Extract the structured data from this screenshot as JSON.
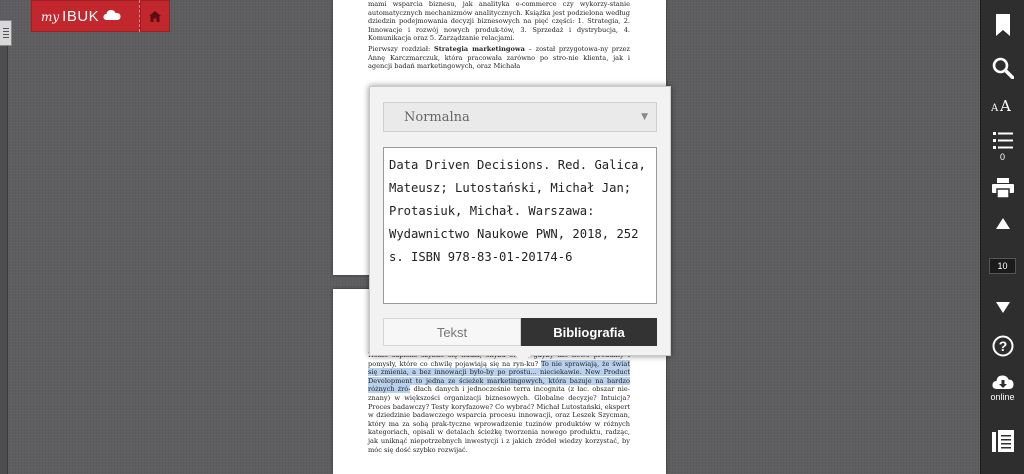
{
  "logo": {
    "my": "my",
    "brand": "IBUK"
  },
  "page1": {
    "paragraphs": [
      "mami wsparcia biznesu, jak analityka e-commerce czy wykorzy-stanie automatycznych mechanizmów analitycznych. Książka jest podzielona według dziedzin podejmowania decyzji biznesowych na pięć części: 1. Strategia, 2. Innowacje i rozwój nowych produk-tów, 3. Sprzedaż i dystrybucja, 4. Komunikacja oraz 5. Zarządzanie relacjami.",
      "Pierwszy rozdział: Strategia marketingowa – został przygotowa-ny przez Annę Karczmarczuk, która pracowała zarówno po stro-nie klienta, jak i agencji badań marketingowych, oraz Michała"
    ],
    "bold_phrase": "Strategia marketingowa"
  },
  "page2": {
    "line1": "Homo sapiens szybko się nudzi, chyba świat, gdyby nie",
    "line2": "nowe produkty i pomysły, które co chwilę pojawiają się na ryn-ku?",
    "highlighted": "To nie sprawiają, że świat się zmienia, a bez innowacji było-by po prostu... nieciekawie. New Product Development to jedna ze ścieżek marketingowych, która bazuje na bardzo różnych źró-",
    "rest": "dłach danych i jednocześnie terra incognita (z łac. obszar nie-znany) w większości organizacji biznesowych. Globalne decyzje? Intuicja? Proces badawczy? Testy koryfazowe? Co wybrać? Michał Lutostański, ekspert w dziedzinie badawczego wsparcia procesu innowacji, oraz Leszek Szycman, który ma za sobą prak-tyczne wprowadzenie tuzinów produktów w różnych kategoriach, opisali w detalach ścieżkę tworzenia nowego produktu, radząc, jak uniknąć niepotrzebnych inwestycji i z jakich źródeł wiedzy korzystać, by móc się dość szybko rozwijać."
  },
  "popup": {
    "style_select": {
      "value": "Normalna"
    },
    "citation": "Data Driven Decisions. Red. Galica, Mateusz; Lutostański, Michał Jan; Protasiuk, Michał. Warszawa: Wydawnictwo Naukowe PWN, 2018, 252 s. ISBN 978-83-01-20174-6",
    "tabs": [
      {
        "label": "Tekst",
        "active": false
      },
      {
        "label": "Bibliografia",
        "active": true
      }
    ]
  },
  "toolbar": {
    "toc_count": "0",
    "page_number": "10",
    "online_label": "online"
  },
  "colors": {
    "brand_red": "#c1272d",
    "toolbar_bg": "#2e2e2e",
    "active_tab": "#333333",
    "highlight": "#b9d1ec"
  }
}
